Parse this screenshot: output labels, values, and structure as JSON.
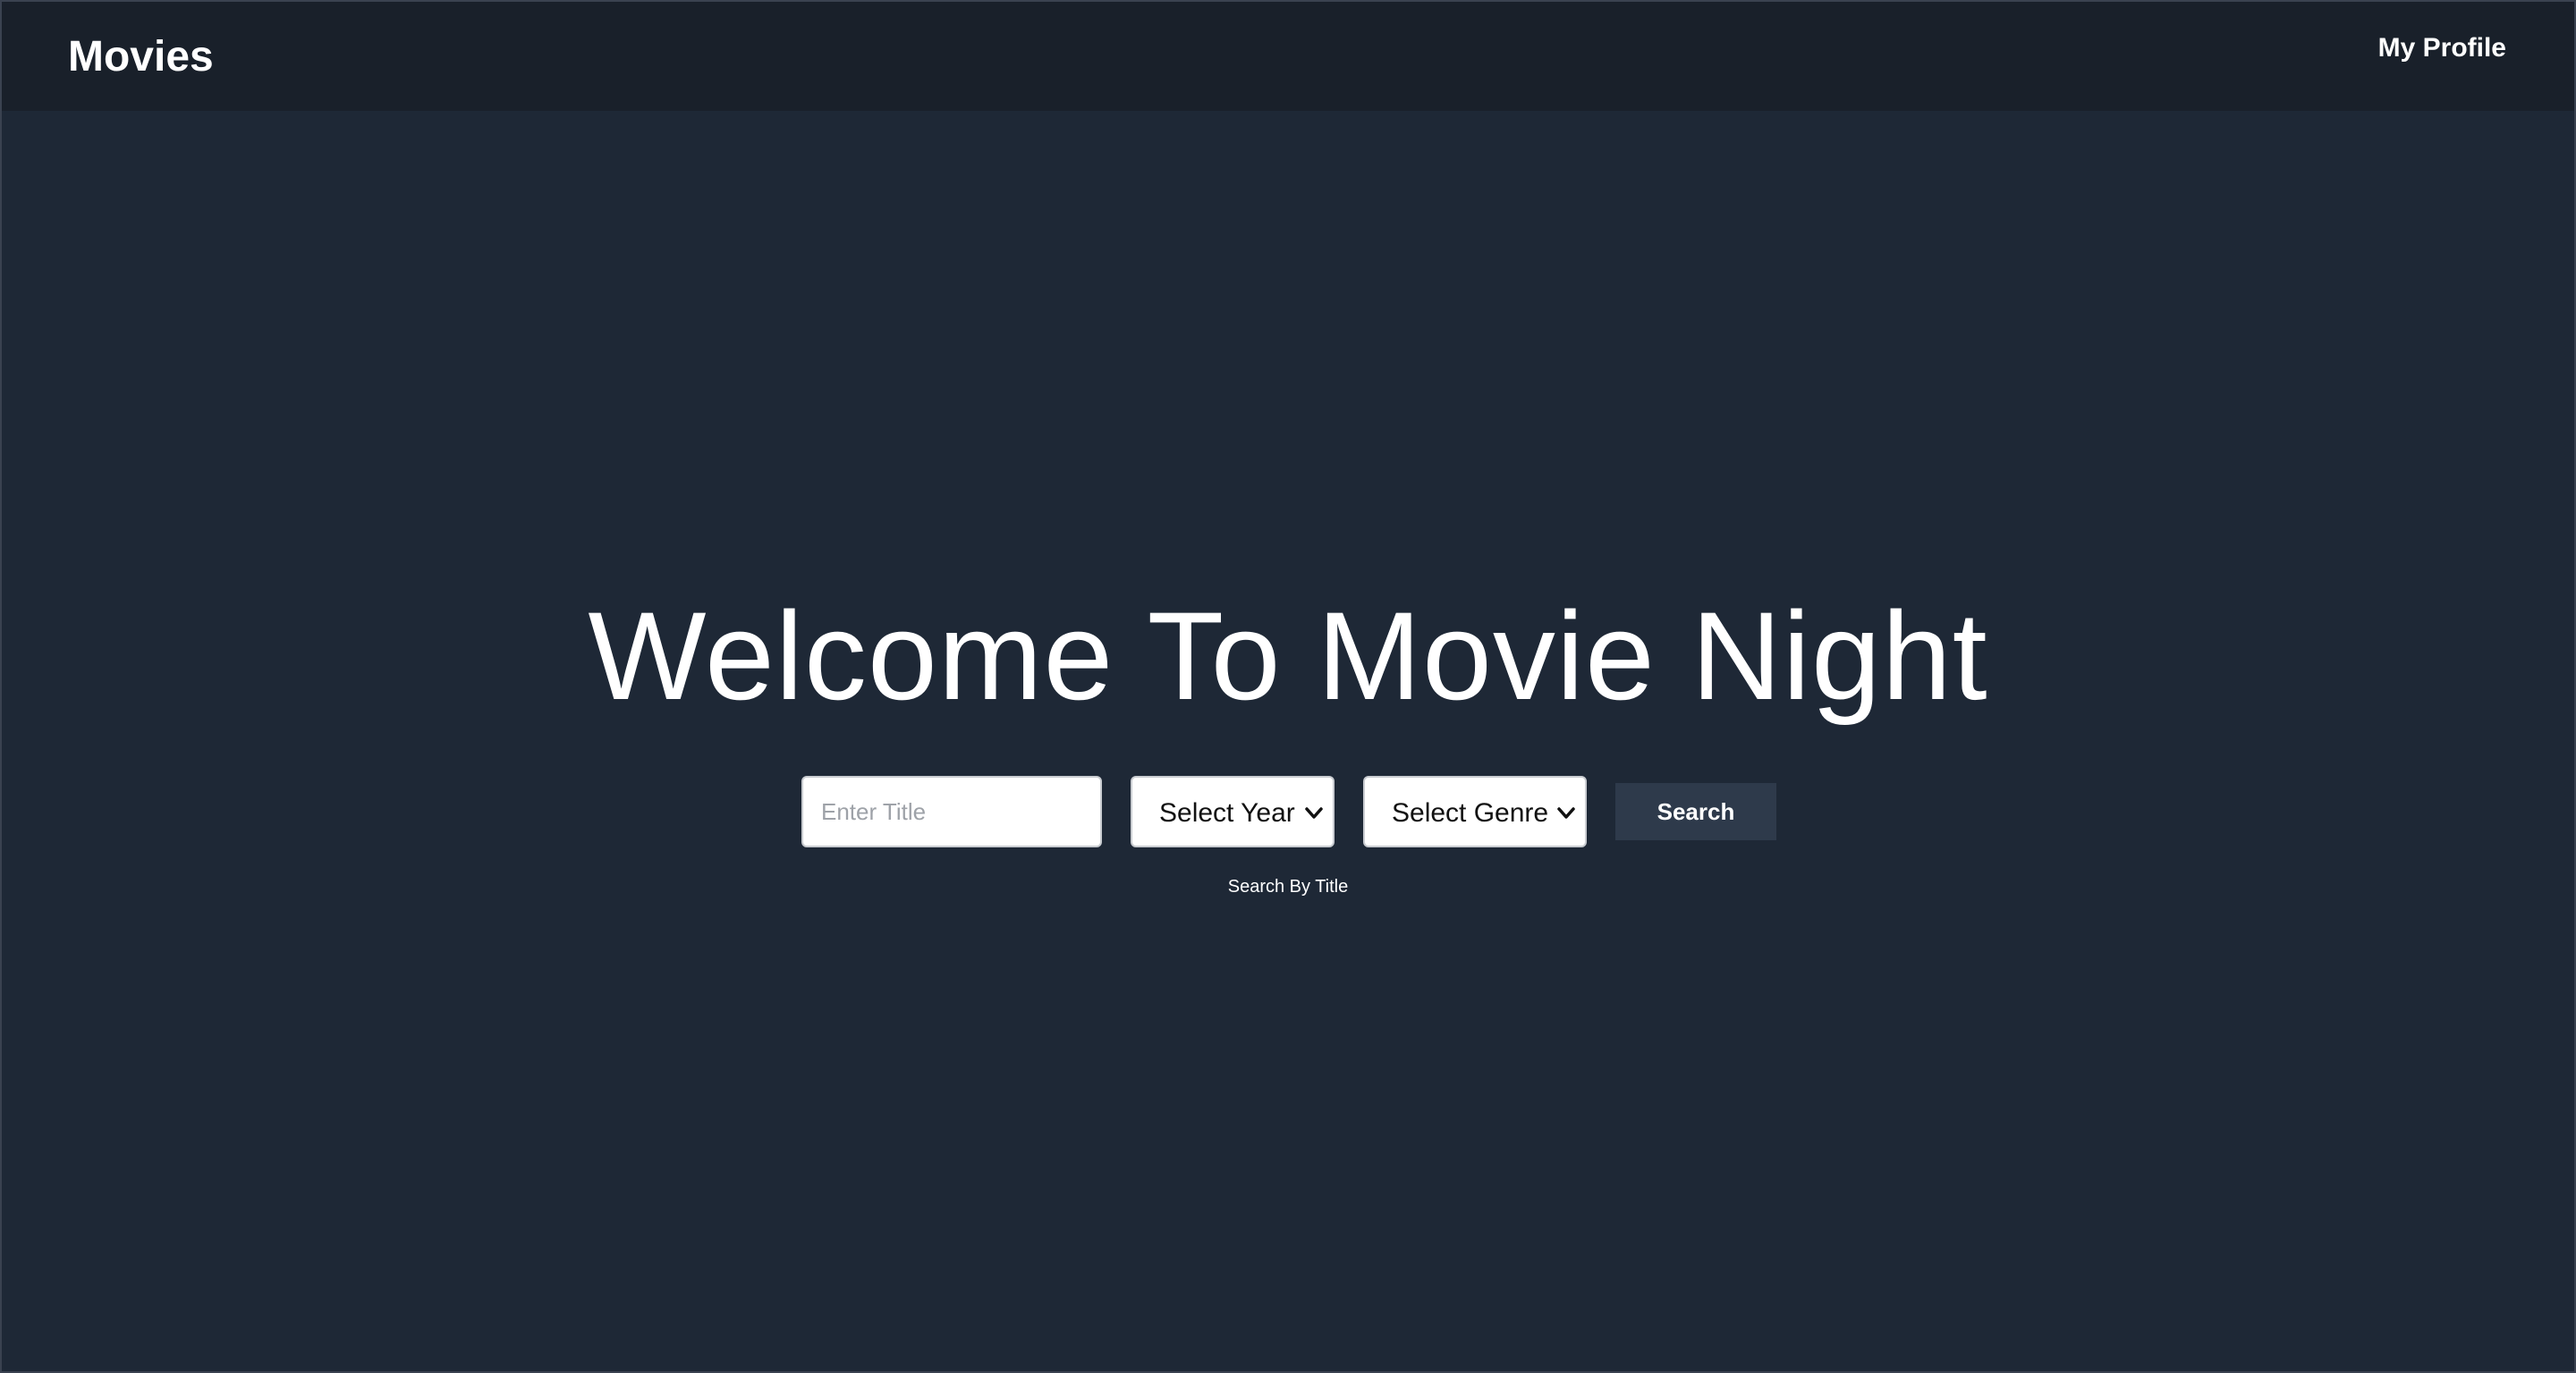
{
  "colors": {
    "page_background": "#1e2836",
    "navbar_background": "#19202a",
    "button_background": "#2e3a4b",
    "text": "#ffffff"
  },
  "navbar": {
    "brand": "Movies",
    "profile_link": "My Profile"
  },
  "hero": {
    "title": "Welcome To Movie Night"
  },
  "search": {
    "title_input": {
      "value": "",
      "placeholder": "Enter Title"
    },
    "year_select": {
      "selected": "Select Year",
      "icon": "chevron-down-icon"
    },
    "genre_select": {
      "selected": "Select Genre",
      "icon": "chevron-down-icon"
    },
    "button_label": "Search",
    "hint": "Search By Title"
  }
}
